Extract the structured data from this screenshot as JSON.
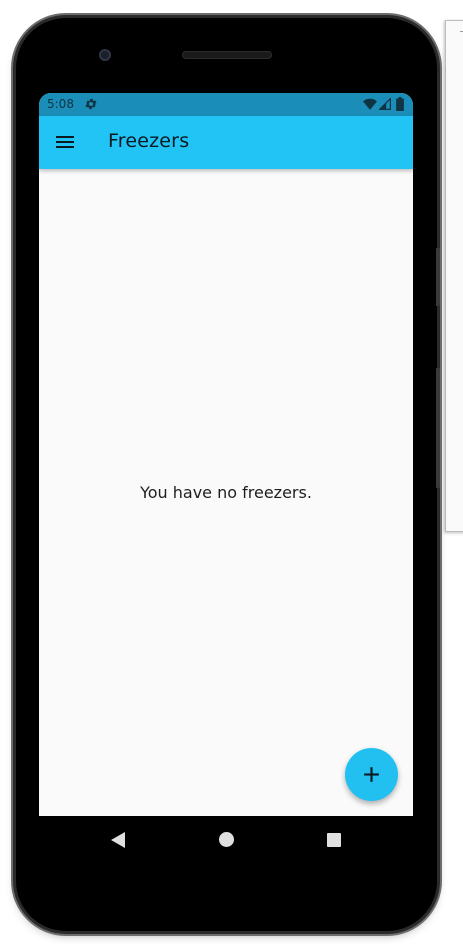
{
  "status_bar": {
    "time": "5:08",
    "icons": [
      "gear-icon",
      "wifi-icon",
      "signal-icon",
      "battery-icon"
    ]
  },
  "app_bar": {
    "menu_icon": "hamburger-menu-icon",
    "title": "Freezers"
  },
  "content": {
    "empty_message": "You have no freezers."
  },
  "fab": {
    "icon": "plus-icon"
  },
  "nav_bar": {
    "icons": [
      "back-icon",
      "home-icon",
      "recents-icon"
    ]
  },
  "colors": {
    "status_bar": "#1a8db8",
    "app_bar": "#22c3f5",
    "fab": "#22c0f1",
    "background": "#fafafa"
  }
}
